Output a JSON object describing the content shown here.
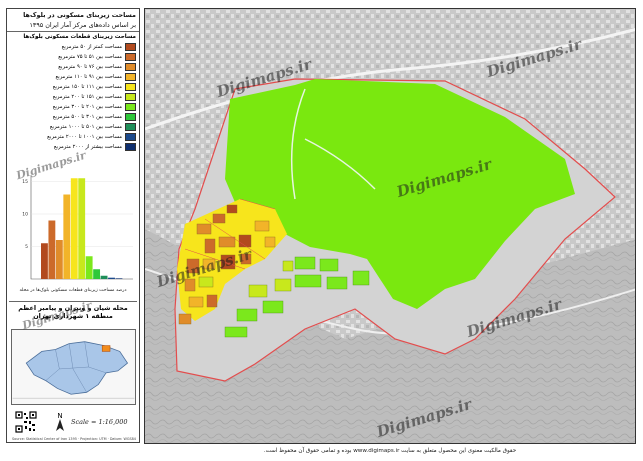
{
  "panel": {
    "title_line1": "مساحت زیربنای مسکونی در بلوک‌ها",
    "title_line2": "بر اساس داده‌های مرکز آمار ایران ۱۳۹۵",
    "legend_heading": "مساحت زیربنای قطعات مسکونی بلوک‌ها",
    "legend": [
      {
        "label": "مساحت کمتر از ۵۰ مترمربع",
        "color": "#b24a1e"
      },
      {
        "label": "مساحت بین ۵۱ تا ۷۵ مترمربع",
        "color": "#cc6a2a"
      },
      {
        "label": "مساحت بین ۷۶ تا ۹۰ مترمربع",
        "color": "#e08c2a"
      },
      {
        "label": "مساحت بین ۹۱ تا ۱۱۰ مترمربع",
        "color": "#f2b429"
      },
      {
        "label": "مساحت بین ۱۱۱ تا ۱۵۰ مترمربع",
        "color": "#f7e51c"
      },
      {
        "label": "مساحت بین ۱۵۱ تا ۲۰۰ مترمربع",
        "color": "#c8e81c"
      },
      {
        "label": "مساحت بین ۲۰۱ تا ۳۰۰ مترمربع",
        "color": "#7be81c"
      },
      {
        "label": "مساحت بین ۳۰۱ تا ۵۰۰ مترمربع",
        "color": "#2fc83a"
      },
      {
        "label": "مساحت بین ۵۰۱ تا ۱۰۰۰ مترمربع",
        "color": "#1f8f5a"
      },
      {
        "label": "مساحت بین ۱۰۰۱ تا ۲۰۰۰ مترمربع",
        "color": "#1c4a8c"
      },
      {
        "label": "مساحت بیشتر از ۲۰۰۰ مترمربع",
        "color": "#0f2f6e"
      }
    ],
    "hist_note": "درصد مساحت زیربنای قطعات مسکونی بلوک‌ها در محله",
    "subtitle_line1": "محله شیان و ونیران و پیامبر اعظم",
    "subtitle_line2": "منطقه ۱ شهرداری تهران",
    "scale": "Scale = 1:16,000",
    "credits": "Source: Statistical Center of Iran 1395 · Projection: UTM · Datum: WGS84"
  },
  "chart_data": {
    "type": "bar",
    "categories": [
      "<50",
      "51-75",
      "76-90",
      "91-110",
      "111-150",
      "151-200",
      "201-300",
      "301-500",
      "501-1000",
      "1001-2000",
      ">2000"
    ],
    "values": [
      5.5,
      9,
      6,
      13,
      15.5,
      15.5,
      3.5,
      1.5,
      0.5,
      0.2,
      0.1
    ],
    "colors": [
      "#b24a1e",
      "#cc6a2a",
      "#e08c2a",
      "#f2b429",
      "#f7e51c",
      "#c8e81c",
      "#7be81c",
      "#2fc83a",
      "#1f8f5a",
      "#1c4a8c",
      "#0f2f6e"
    ],
    "ylim": [
      0,
      16
    ],
    "yticks": [
      5,
      10,
      15
    ],
    "xlabel": "",
    "ylabel": "",
    "title": ""
  },
  "watermark": "Digimaps.ir",
  "footer": "حقوق مالکیت معنوی این محصول متعلق به سایت www.digimaps.ir بوده و تمامی حقوق آن محفوظ است."
}
